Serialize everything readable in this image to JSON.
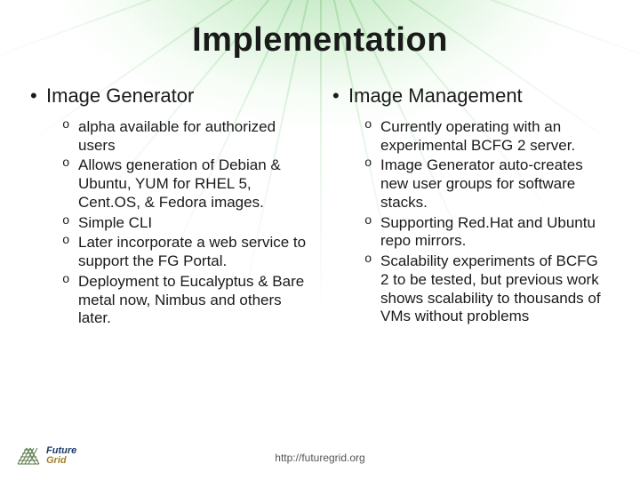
{
  "title": "Implementation",
  "left": {
    "heading": "Image Generator",
    "items": [
      "alpha available for authorized users",
      "Allows generation of Debian & Ubuntu, YUM for RHEL 5, Cent.OS, & Fedora images.",
      "Simple CLI",
      "Later incorporate a web service to support the FG Portal.",
      "Deployment to Eucalyptus & Bare metal now, Nimbus and others later."
    ]
  },
  "right": {
    "heading": "Image Management",
    "items": [
      "Currently operating with an experimental BCFG 2 server.",
      "Image Generator auto-creates new user groups for software stacks.",
      "Supporting Red.Hat and Ubuntu repo mirrors.",
      "Scalability experiments of BCFG 2 to be tested, but previous work shows scalability to thousands of VMs without problems"
    ]
  },
  "footer_url": "http://futuregrid.org",
  "logo": {
    "line1": "Future",
    "line2": "Grid"
  }
}
